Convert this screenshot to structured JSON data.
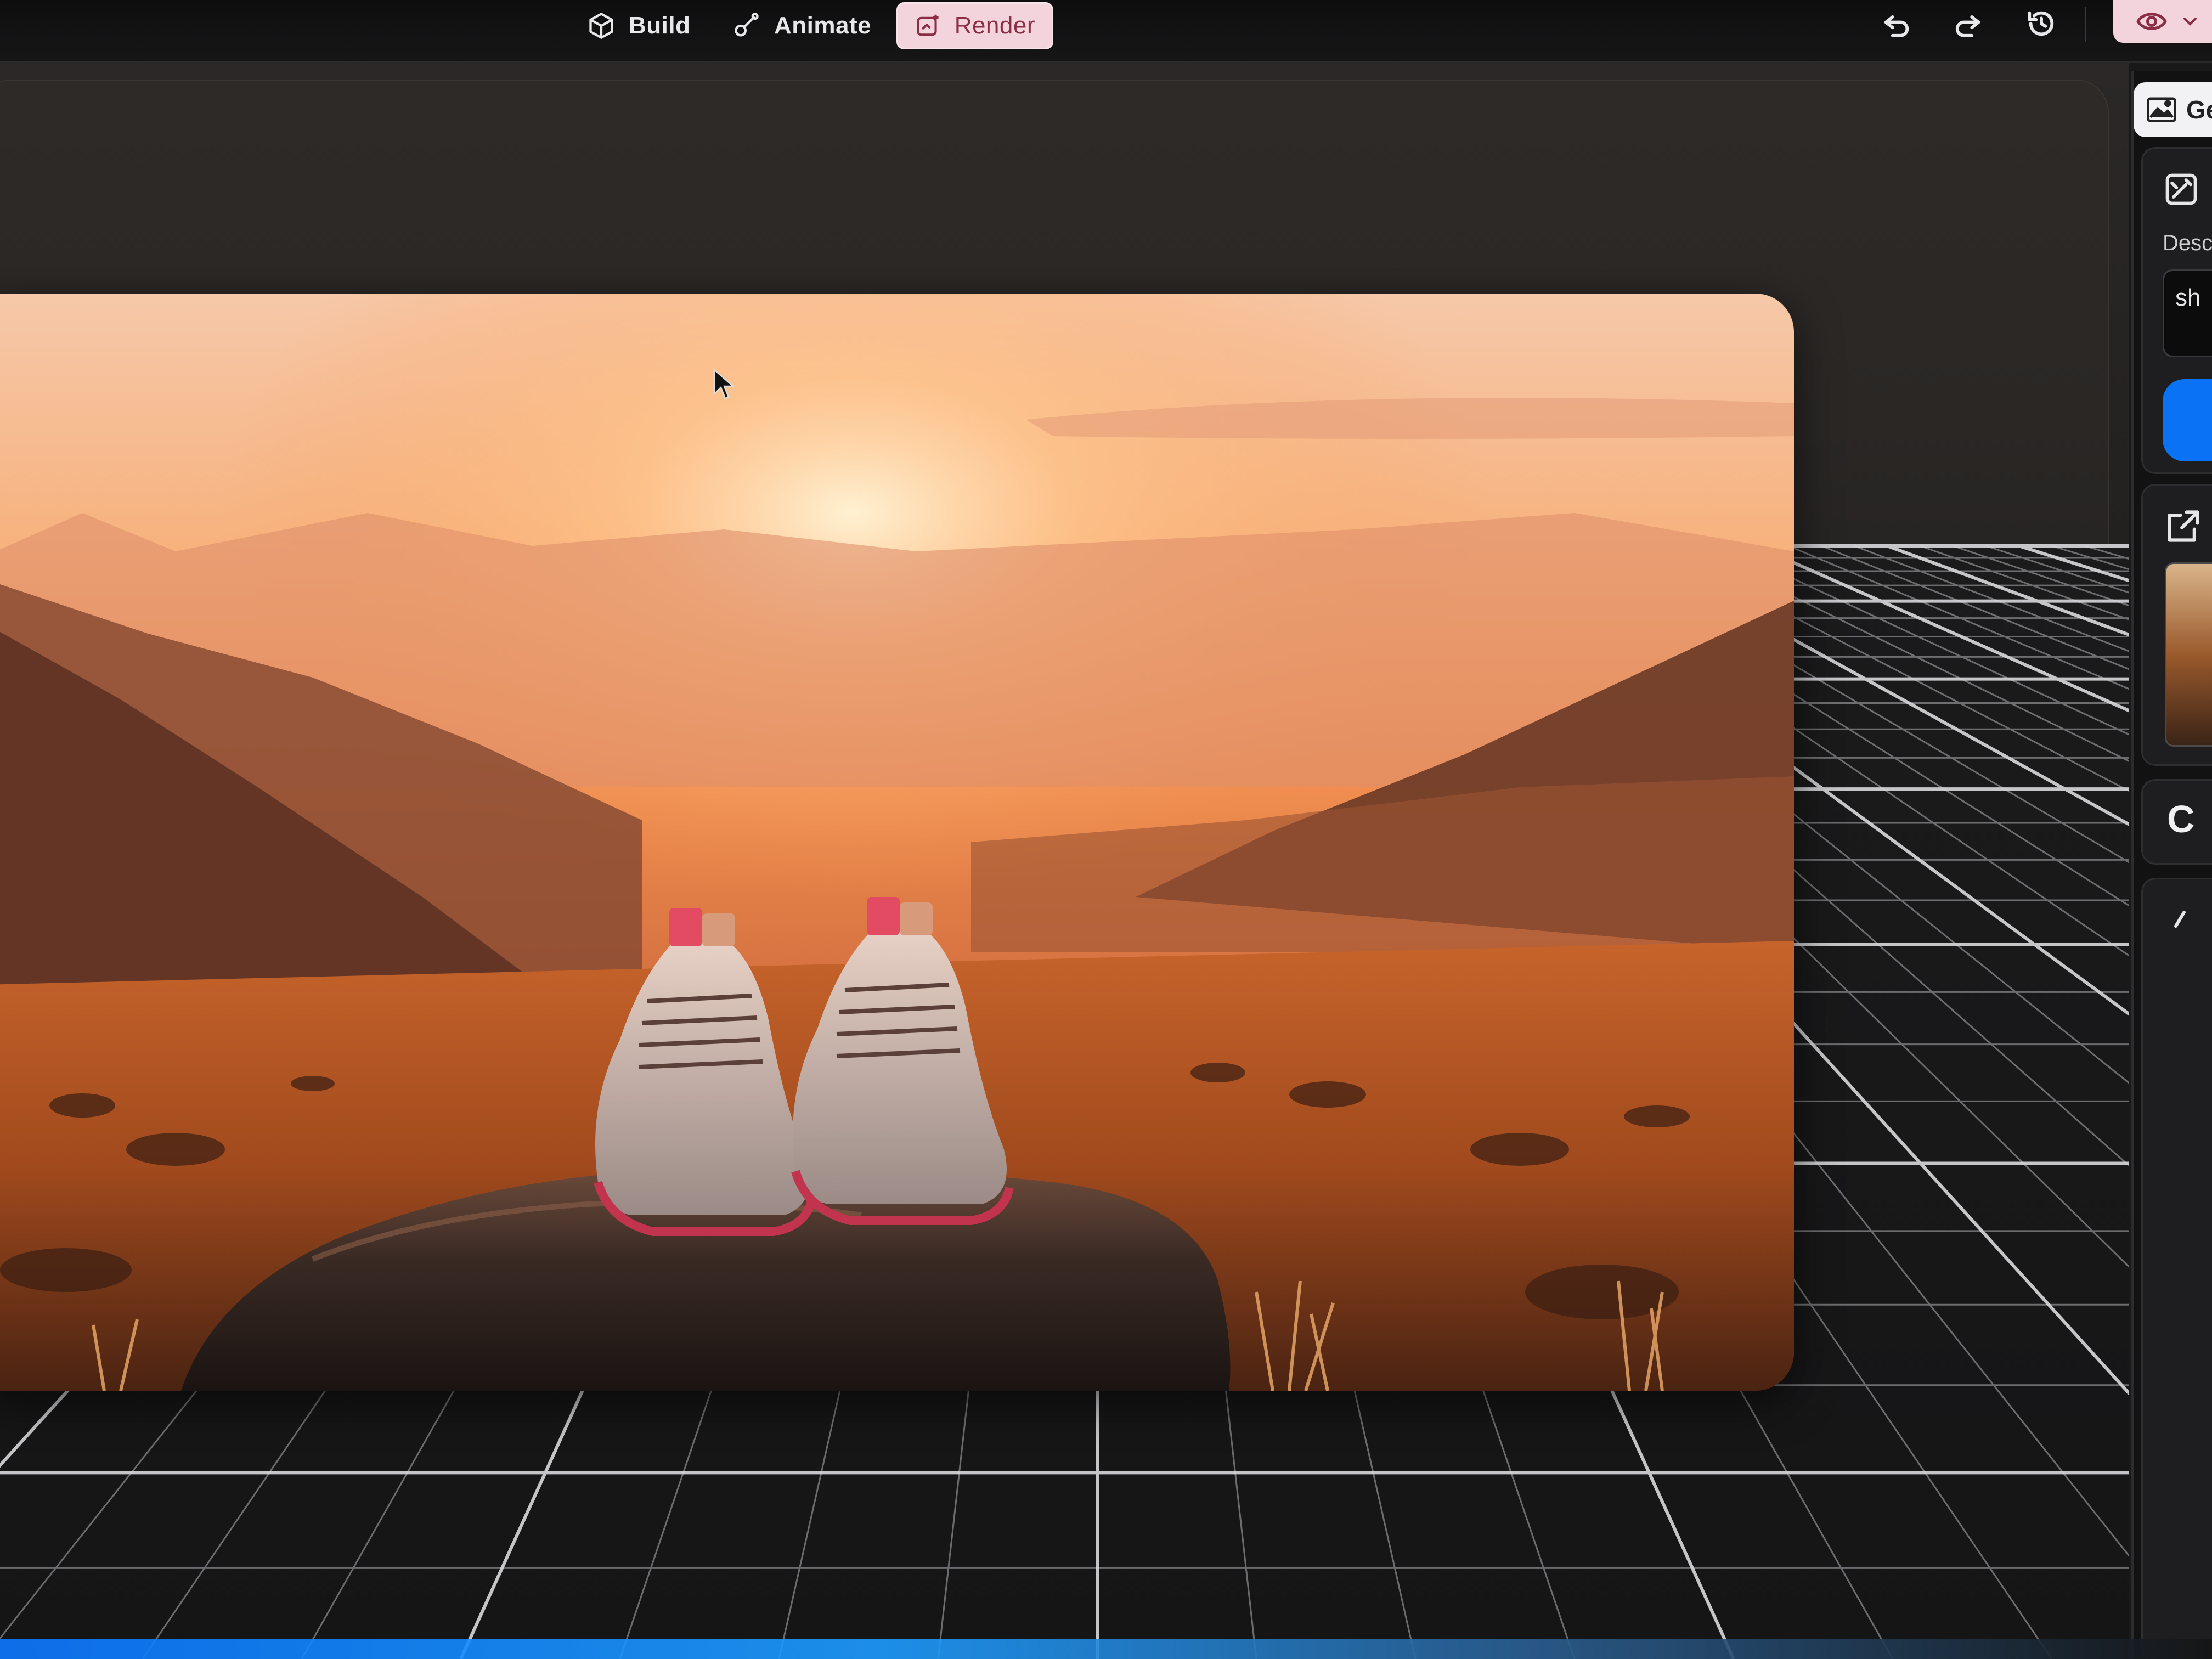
{
  "toolbar": {
    "modes": [
      {
        "label": "Build",
        "icon": "cube-icon",
        "active": false
      },
      {
        "label": "Animate",
        "icon": "animate-icon",
        "active": false
      },
      {
        "label": "Render",
        "icon": "render-icon",
        "active": true
      }
    ],
    "actions": [
      "undo-icon",
      "redo-icon",
      "history-icon"
    ],
    "view_toggle_icon": "eye-icon",
    "accent_color": "#f4d4dc"
  },
  "right_panel": {
    "tab_label": "Ge",
    "tab_icon": "image-icon",
    "describe_label": "Desc",
    "prompt_value": "sh",
    "generate_button_color": "#0a72f5",
    "export_icon": "export-icon",
    "card_three_label": "C"
  },
  "viewport": {
    "scene": "Sneakers on rock, mountain sunset",
    "cursor_icon": "pointer-cursor-icon"
  }
}
